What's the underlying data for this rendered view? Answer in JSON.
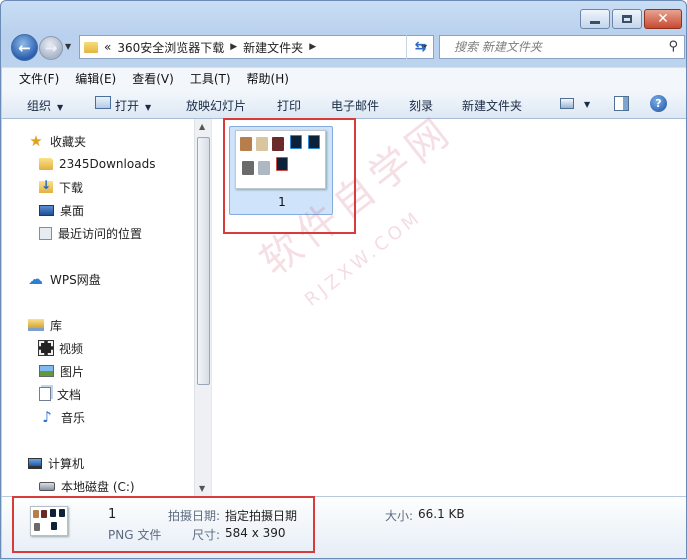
{
  "window": {
    "minimize_icon": "minimize-icon",
    "maximize_icon": "maximize-icon",
    "close_icon": "close-icon"
  },
  "address_bar": {
    "overflow": "«",
    "crumbs": [
      "360安全浏览器下载",
      "新建文件夹"
    ],
    "search_placeholder": "搜索 新建文件夹"
  },
  "menu": [
    "文件(F)",
    "编辑(E)",
    "查看(V)",
    "工具(T)",
    "帮助(H)"
  ],
  "toolbar": {
    "organize": "组织",
    "open": "打开",
    "slideshow": "放映幻灯片",
    "print": "打印",
    "email": "电子邮件",
    "burn": "刻录",
    "new_folder": "新建文件夹",
    "help_icon": "help-icon"
  },
  "nav_pane": {
    "favorites": "收藏夹",
    "favorites_items": [
      "2345Downloads",
      "下载",
      "桌面",
      "最近访问的位置"
    ],
    "wps": "WPS网盘",
    "libraries": "库",
    "library_items": [
      "视频",
      "图片",
      "文档",
      "音乐"
    ],
    "computer": "计算机",
    "computer_items": [
      "本地磁盘 (C:)"
    ]
  },
  "content": {
    "files": [
      {
        "name": "1",
        "selected": true
      }
    ]
  },
  "details": {
    "name": "1",
    "type": "PNG 文件",
    "date_label": "拍摄日期:",
    "date_value": "指定拍摄日期",
    "size_label": "大小:",
    "size_value": "66.1 KB",
    "dim_label": "尺寸:",
    "dim_value": "584 x 390"
  },
  "watermark": {
    "text": "软件自学网",
    "sub": "RJZXW.COM"
  },
  "colors": {
    "highlight": "#d93b3b",
    "selection": "#cfe3fb",
    "accent": "#2a5fae"
  }
}
